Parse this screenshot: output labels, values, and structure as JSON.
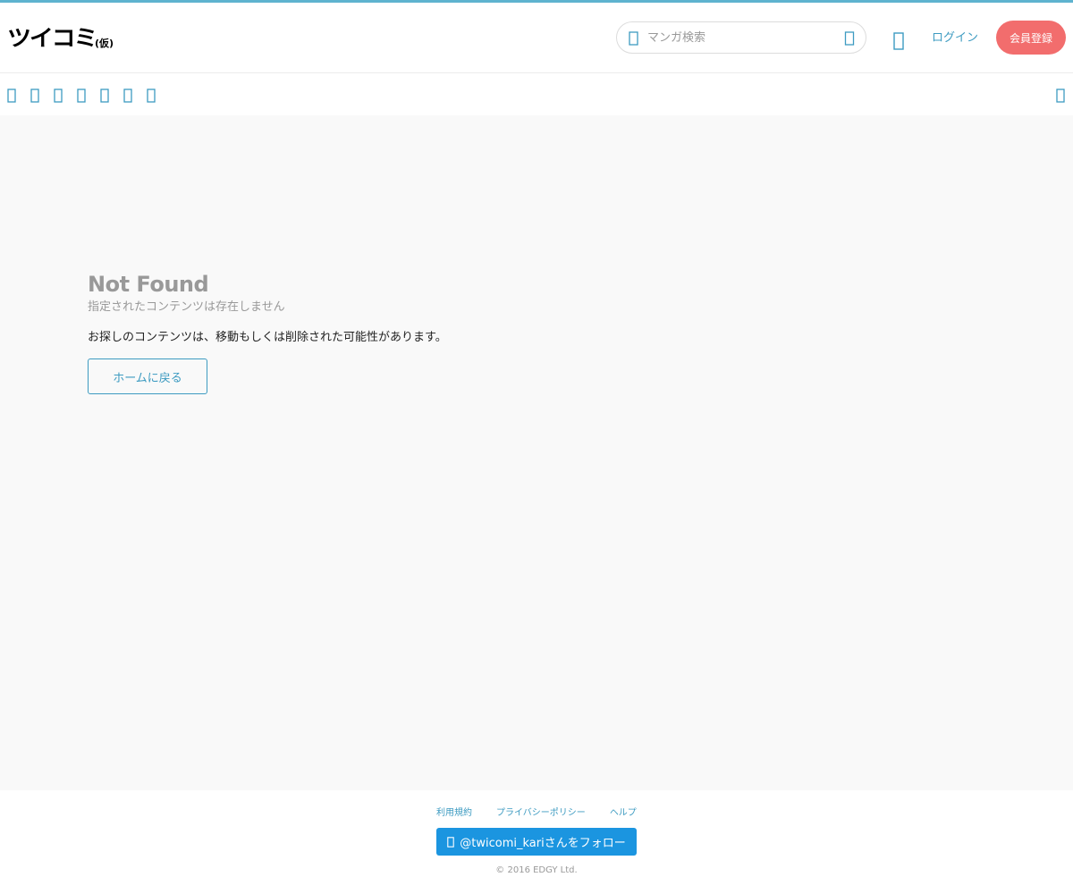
{
  "header": {
    "logo_text": "ツイコミ",
    "logo_sub": "(仮)",
    "search_placeholder": "マンガ検索",
    "login_label": "ログイン",
    "signup_label": "会員登録"
  },
  "nav": {
    "icons": [
      "nav-icon-1",
      "nav-icon-2",
      "nav-icon-3",
      "nav-icon-4",
      "nav-icon-5",
      "nav-icon-6",
      "nav-icon-7"
    ],
    "right_icon": "nav-icon-right"
  },
  "main": {
    "title": "Not Found",
    "subtitle": "指定されたコンテンツは存在しません",
    "message": "お探しのコンテンツは、移動もしくは削除された可能性があります。",
    "home_button": "ホームに戻る"
  },
  "footer": {
    "links": [
      "利用規約",
      "プライバシーポリシー",
      "ヘルプ"
    ],
    "follow_button": "@twicomi_kariさんをフォロー",
    "copyright": "© 2016 EDGY Ltd."
  },
  "colors": {
    "accent": "#3d9bc1",
    "signup": "#f26d6d",
    "twitter": "#1b95e0"
  }
}
